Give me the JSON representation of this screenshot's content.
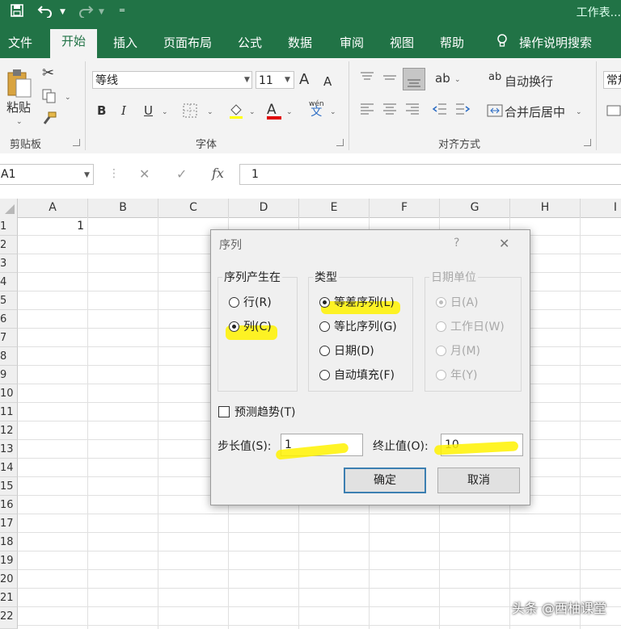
{
  "window": {
    "title": "工作表..."
  },
  "tabs": [
    "文件",
    "开始",
    "插入",
    "页面布局",
    "公式",
    "数据",
    "审阅",
    "视图",
    "帮助",
    "操作说明搜索"
  ],
  "ribbon": {
    "clipboard": {
      "paste": "粘贴",
      "label": "剪贴板"
    },
    "font": {
      "name": "等线",
      "size": "11",
      "grow": "A",
      "shrink": "A",
      "bold": "B",
      "italic": "I",
      "underline": "U",
      "label": "字体",
      "phonetic": "wén",
      "phonetic2": "文",
      "color_letter": "A"
    },
    "alignment": {
      "wrap": "自动换行",
      "merge": "合并后居中",
      "label": "对齐方式"
    },
    "number": {
      "format": "常规"
    }
  },
  "formula_bar": {
    "name_box": "A1",
    "fx": "fx",
    "value": "1",
    "cancel": "✕",
    "enter": "✓"
  },
  "columns": [
    "A",
    "B",
    "C",
    "D",
    "E",
    "F",
    "G",
    "H",
    "I"
  ],
  "rows": [
    "1",
    "2",
    "3",
    "4",
    "5",
    "6",
    "7",
    "8",
    "9",
    "10",
    "11",
    "12",
    "13",
    "14",
    "15",
    "16",
    "17",
    "18",
    "19",
    "20",
    "21",
    "22"
  ],
  "cells": {
    "A1": "1"
  },
  "dialog": {
    "title": "序列",
    "help": "?",
    "close": "✕",
    "series_in": {
      "title": "序列产生在",
      "options": [
        "行(R)",
        "列(C)"
      ],
      "selected": 1
    },
    "type": {
      "title": "类型",
      "options": [
        "等差序列(L)",
        "等比序列(G)",
        "日期(D)",
        "自动填充(F)"
      ],
      "selected": 0
    },
    "date_unit": {
      "title": "日期单位",
      "options": [
        "日(A)",
        "工作日(W)",
        "月(M)",
        "年(Y)"
      ],
      "selected": 0,
      "enabled": false
    },
    "trend": {
      "label": "预测趋势(T)",
      "checked": false
    },
    "step": {
      "label": "步长值(S):",
      "value": "1"
    },
    "stop": {
      "label": "终止值(O):",
      "value": "10"
    },
    "ok": "确定",
    "cancel": "取消"
  },
  "watermark": "头条 @西柚课堂",
  "colors": {
    "excel_green": "#217346",
    "highlight": "#fff200"
  }
}
